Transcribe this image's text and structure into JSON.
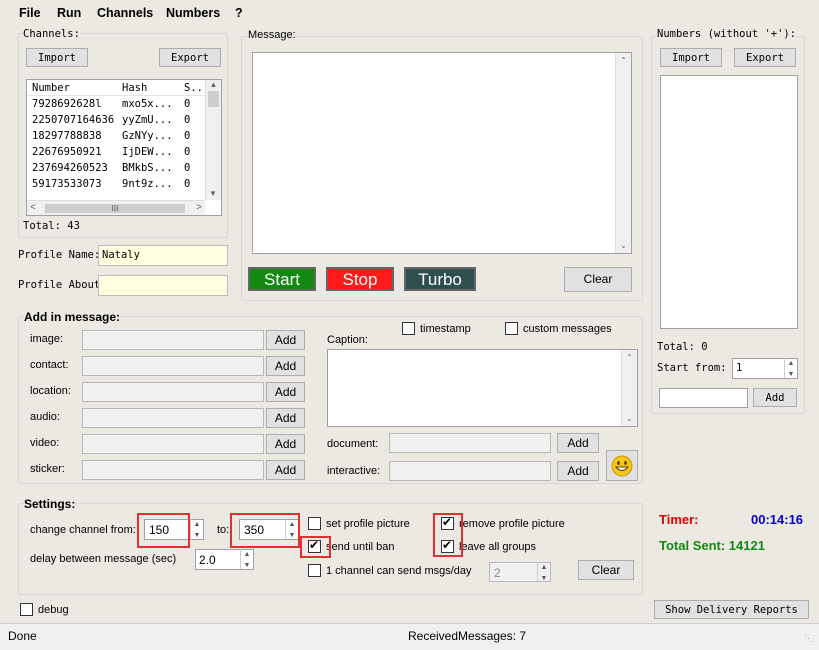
{
  "menu": [
    "File",
    "Run",
    "Channels",
    "Numbers",
    "?"
  ],
  "channels": {
    "title": "Channels:",
    "import": "Import",
    "export": "Export",
    "columns": [
      "Number",
      "Hash",
      "S.."
    ],
    "rows": [
      [
        "7928692628l",
        "mxo5x...",
        "0"
      ],
      [
        "2250707164636",
        "yyZmU...",
        "0"
      ],
      [
        "18297788838",
        "GzNYy...",
        "0"
      ],
      [
        "22676950921",
        "IjDEW...",
        "0"
      ],
      [
        "237694260523",
        "BMkbS...",
        "0"
      ],
      [
        "59173533073",
        "9nt9z...",
        "0"
      ]
    ],
    "total": "Total: 43"
  },
  "profile": {
    "name_label": "Profile Name:",
    "name_value": "Nataly",
    "about_label": "Profile About:",
    "about_value": ""
  },
  "message": {
    "title": "Message:",
    "start": "Start",
    "stop": "Stop",
    "turbo": "Turbo",
    "clear": "Clear"
  },
  "numbers": {
    "title": "Numbers (without '+'):",
    "import": "Import",
    "export": "Export",
    "total": "Total: 0",
    "start_from_label": "Start from:",
    "start_from_value": "1",
    "add": "Add"
  },
  "add_in_message": {
    "title": "Add in message:",
    "rows": [
      {
        "label": "image:",
        "btn": "Add"
      },
      {
        "label": "contact:",
        "btn": "Add"
      },
      {
        "label": "location:",
        "btn": "Add"
      },
      {
        "label": "audio:",
        "btn": "Add"
      },
      {
        "label": "video:",
        "btn": "Add"
      },
      {
        "label": "sticker:",
        "btn": "Add"
      }
    ],
    "timestamp": "timestamp",
    "custom_messages": "custom messages",
    "caption": "Caption:",
    "document": "document:",
    "interactive": "interactive:",
    "add": "Add"
  },
  "settings": {
    "title": "Settings:",
    "change_channel_from": "change channel from:",
    "from_value": "150",
    "to": "to:",
    "to_value": "350",
    "delay_label": "delay between message (sec)",
    "delay_value": "2.0",
    "set_profile_picture": "set profile picture",
    "send_until_ban": "send until ban",
    "one_channel": "1 channel can send msgs/day",
    "one_channel_value": "2",
    "remove_profile_picture": "remove profile picture",
    "leave_all_groups": "leave all groups",
    "clear": "Clear"
  },
  "timer": {
    "label": "Timer:",
    "value": "00:14:16",
    "total_sent": "Total Sent: 14121"
  },
  "debug": "debug",
  "show_delivery": "Show Delivery Reports",
  "status": {
    "left": "Done",
    "center": "ReceivedMessages: 7"
  },
  "colors": {
    "start": "#128a12",
    "stop": "#ff1a1a",
    "turbo": "#2f4f4f",
    "timer_label": "#e00000",
    "timer_value": "#0000cc",
    "total_sent": "#108a10"
  }
}
